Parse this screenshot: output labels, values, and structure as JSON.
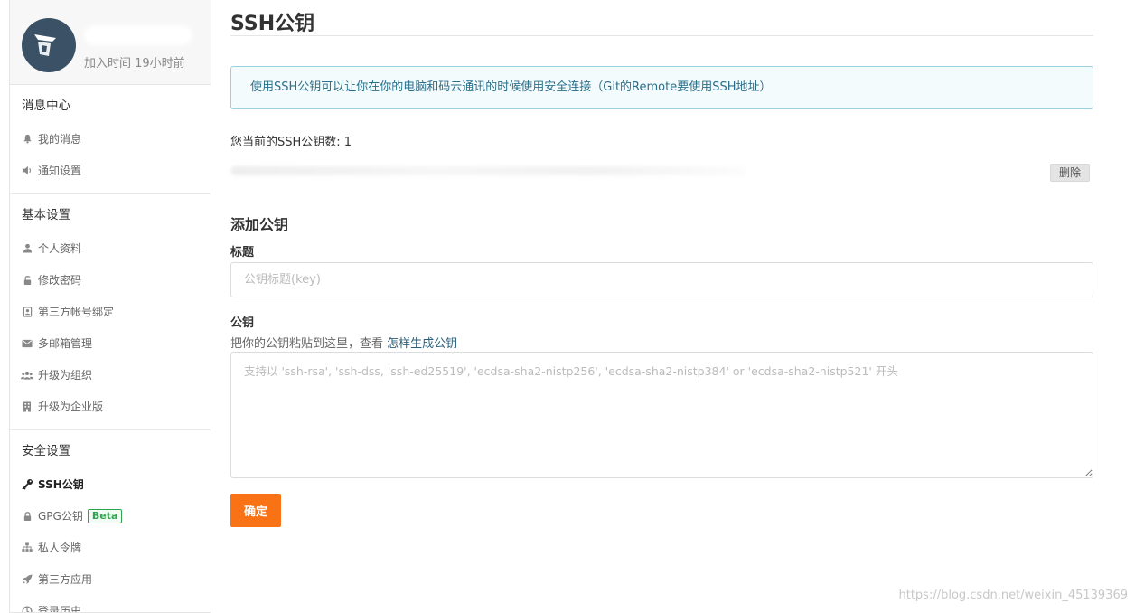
{
  "profile": {
    "join_time": "加入时间 19小时前"
  },
  "sidebar": {
    "sections": [
      {
        "title": "消息中心",
        "items": [
          {
            "label": "我的消息",
            "icon": "bell-icon"
          },
          {
            "label": "通知设置",
            "icon": "speaker-icon"
          }
        ]
      },
      {
        "title": "基本设置",
        "items": [
          {
            "label": "个人资料",
            "icon": "user-icon"
          },
          {
            "label": "修改密码",
            "icon": "unlock-icon"
          },
          {
            "label": "第三方帐号绑定",
            "icon": "contact-card-icon"
          },
          {
            "label": "多邮箱管理",
            "icon": "envelope-icon"
          },
          {
            "label": "升级为组织",
            "icon": "users-icon"
          },
          {
            "label": "升级为企业版",
            "icon": "building-icon"
          }
        ]
      },
      {
        "title": "安全设置",
        "items": [
          {
            "label": "SSH公钥",
            "icon": "key-icon",
            "active": true
          },
          {
            "label": "GPG公钥",
            "icon": "lock-icon",
            "badge": "Beta"
          },
          {
            "label": "私人令牌",
            "icon": "sitemap-icon"
          },
          {
            "label": "第三方应用",
            "icon": "rocket-icon"
          },
          {
            "label": "登录历史",
            "icon": "history-icon"
          }
        ]
      }
    ]
  },
  "main": {
    "title": "SSH公钥",
    "info": "使用SSH公钥可以让你在你的电脑和码云通讯的时候使用安全连接（Git的Remote要使用SSH地址）",
    "key_count": "您当前的SSH公钥数: 1",
    "delete_label": "删除",
    "add_title": "添加公钥",
    "title_label": "标题",
    "title_placeholder": "公钥标题(key)",
    "key_label": "公钥",
    "key_hint_text": "把你的公钥粘贴到这里，查看 ",
    "key_hint_link": "怎样生成公钥",
    "key_placeholder": "支持以 'ssh-rsa', 'ssh-dss, 'ssh-ed25519', 'ecdsa-sha2-nistp256', 'ecdsa-sha2-nistp384' or 'ecdsa-sha2-nistp521' 开头",
    "confirm_label": "确定"
  },
  "watermark": "https://blog.csdn.net/weixin_45139369",
  "colors": {
    "accent": "#f97316",
    "info_border": "#9bd0e0",
    "info_bg": "#f3fbfd",
    "beta": "#2ea44f"
  }
}
